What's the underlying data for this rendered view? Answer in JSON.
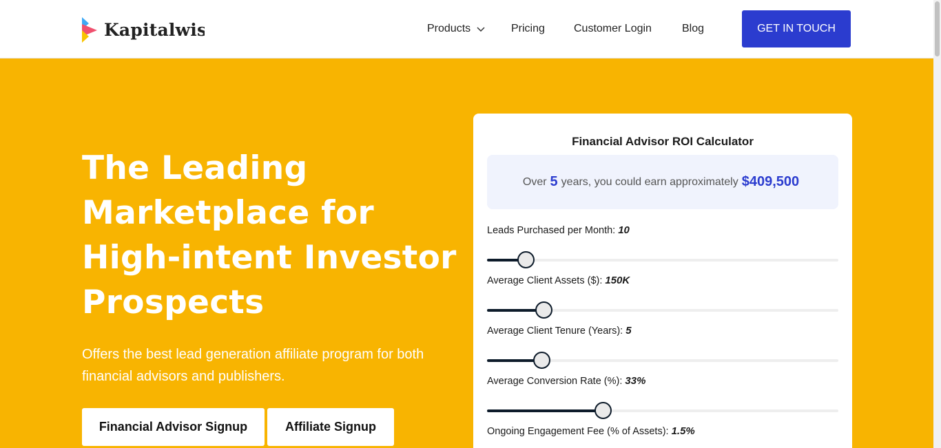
{
  "header": {
    "brand": "Kapitalwise",
    "nav": {
      "products": "Products",
      "pricing": "Pricing",
      "login": "Customer Login",
      "blog": "Blog"
    },
    "cta": "GET IN TOUCH"
  },
  "hero": {
    "title": "The Leading Marketplace for High-intent Investor Prospects",
    "subtitle": "Offers the best lead generation affiliate program for both financial advisors and publishers.",
    "buttons": {
      "advisor": "Financial Advisor Signup",
      "affiliate": "Affiliate Signup"
    }
  },
  "calculator": {
    "title": "Financial Advisor ROI Calculator",
    "summary": {
      "prefix": "Over",
      "years": "5",
      "middle": "years, you could earn approximately",
      "amount": "$409,500"
    },
    "fields": [
      {
        "label": "Leads Purchased per Month:",
        "value": "10",
        "level": 0.11
      },
      {
        "label": "Average Client Assets ($):",
        "value": "150K",
        "level": 0.16
      },
      {
        "label": "Average Client Tenure (Years):",
        "value": "5",
        "level": 0.155
      },
      {
        "label": "Average Conversion Rate (%):",
        "value": "33%",
        "level": 0.33
      },
      {
        "label": "Ongoing Engagement Fee (% of Assets):",
        "value": "1.5%",
        "level": null
      }
    ]
  }
}
